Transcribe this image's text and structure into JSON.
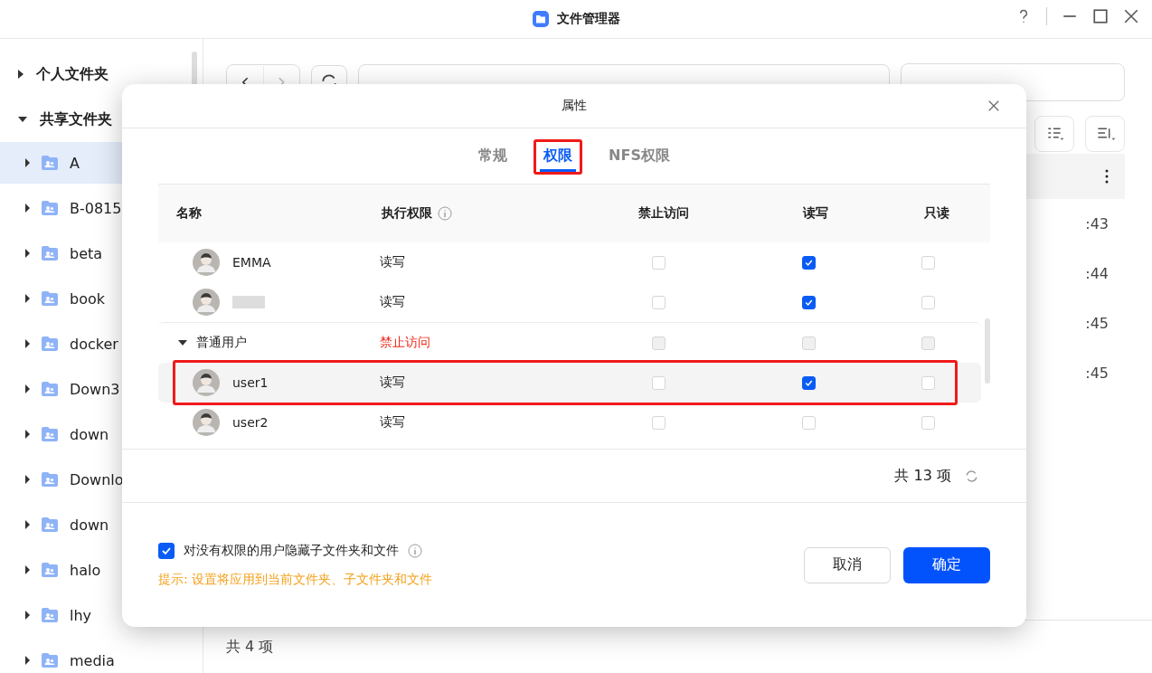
{
  "window": {
    "title": "文件管理器"
  },
  "sidebar": {
    "items": [
      {
        "label": "个人文件夹",
        "expanded": false
      },
      {
        "label": "共享文件夹",
        "expanded": true,
        "children": [
          {
            "label": "A",
            "selected": true
          },
          {
            "label": "B-0815",
            "selected": false
          },
          {
            "label": "beta",
            "selected": false
          },
          {
            "label": "book",
            "selected": false
          },
          {
            "label": "docker",
            "selected": false
          },
          {
            "label": "Down3",
            "selected": false
          },
          {
            "label": "down",
            "selected": false
          },
          {
            "label": "Downlo",
            "selected": false
          },
          {
            "label": "down",
            "selected": false
          },
          {
            "label": "halo",
            "selected": false
          },
          {
            "label": "lhy",
            "selected": false
          },
          {
            "label": "media",
            "selected": false
          }
        ]
      }
    ]
  },
  "file_list": {
    "times": [
      ":43",
      ":44",
      ":45",
      ":45"
    ]
  },
  "status_bar": "共 4 项",
  "dialog": {
    "title": "属性",
    "tabs": [
      {
        "label": "常规",
        "selected": false,
        "highlighted": false
      },
      {
        "label": "权限",
        "selected": true,
        "highlighted": true
      },
      {
        "label": "NFS权限",
        "selected": false,
        "highlighted": false
      }
    ],
    "columns": [
      "名称",
      "执行权限",
      "禁止访问",
      "读写",
      "只读"
    ],
    "rows": [
      {
        "kind": "user",
        "name": "EMMA",
        "permission": "读写",
        "deny": false,
        "read_write": true,
        "read_only": false,
        "highlighted": false
      },
      {
        "kind": "user",
        "name_redacted": true,
        "permission": "读写",
        "deny": false,
        "read_write": true,
        "read_only": false,
        "highlighted": false
      },
      {
        "kind": "group",
        "name": "普通用户",
        "expanded": true,
        "permission": "禁止访问",
        "warning": true,
        "disabled": true
      },
      {
        "kind": "user",
        "name": "user1",
        "permission": "读写",
        "deny": false,
        "read_write": true,
        "read_only": false,
        "highlighted": true
      },
      {
        "kind": "user",
        "name": "user2",
        "permission": "读写",
        "deny": false,
        "read_write": false,
        "read_only": false,
        "highlighted": false
      }
    ],
    "count": "共 13 项",
    "hide_option": {
      "label": "对没有权限的用户隐藏子文件夹和文件",
      "checked": true
    },
    "hint": "提示: 设置将应用到当前文件夹、子文件夹和文件",
    "buttons": [
      {
        "label": "取消",
        "kind": "secondary"
      },
      {
        "label": "确定",
        "kind": "primary"
      }
    ]
  }
}
